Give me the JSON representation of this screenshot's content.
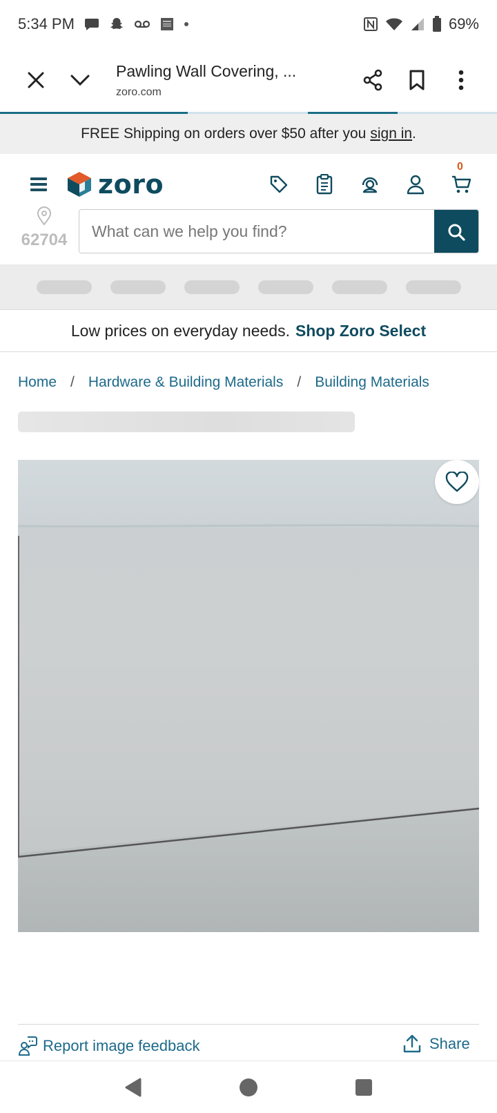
{
  "status_bar": {
    "time": "5:34 PM",
    "battery": "69%",
    "icons": [
      "message-icon",
      "snapchat-icon",
      "voicemail-icon",
      "news-icon",
      "dot-icon",
      "nfc-icon",
      "wifi-icon",
      "signal-icon",
      "battery-icon"
    ]
  },
  "tab_toolbar": {
    "title": "Pawling Wall Covering, ...",
    "url": "zoro.com"
  },
  "promo": {
    "text": "FREE Shipping on orders over $50 after you",
    "link": "sign in",
    "suffix": "."
  },
  "header": {
    "logo_text": "zoro",
    "cart_count": "0",
    "zip": "62704",
    "search_placeholder": "What can we help you find?"
  },
  "select_banner": {
    "text": "Low prices on everyday needs.",
    "link": "Shop Zoro Select"
  },
  "breadcrumb": [
    "Home",
    "Hardware & Building Materials",
    "Building Materials"
  ],
  "breadcrumb_separator": "/",
  "footer_actions": {
    "feedback": "Report image feedback",
    "share": "Share"
  },
  "colors": {
    "brand": "#0f4b5f",
    "link": "#1d6a8a",
    "cart_count": "#d55a1a"
  }
}
